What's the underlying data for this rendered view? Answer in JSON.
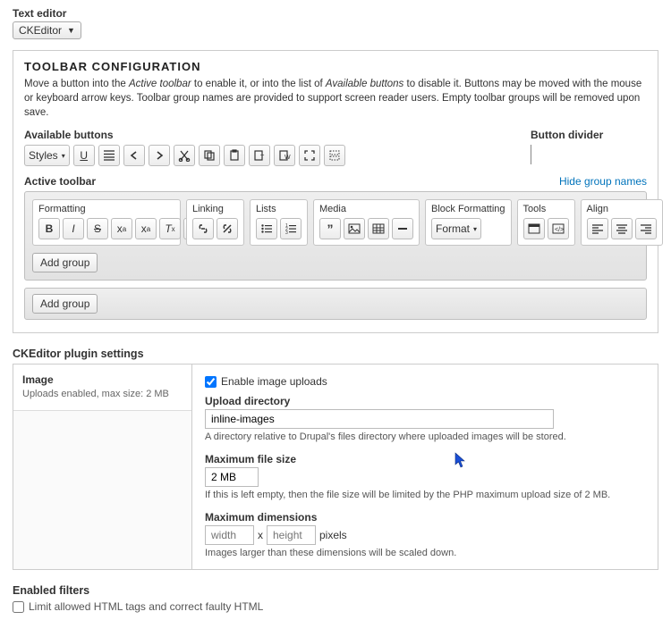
{
  "textEditor": {
    "label": "Text editor",
    "selected": "CKEditor"
  },
  "toolbarConfig": {
    "title": "TOOLBAR CONFIGURATION",
    "desc_pre": "Move a button into the ",
    "desc_em1": "Active toolbar",
    "desc_mid": " to enable it, or into the list of ",
    "desc_em2": "Available buttons",
    "desc_post": " to disable it. Buttons may be moved with the mouse or keyboard arrow keys. Toolbar group names are provided to support screen reader users. Empty toolbar groups will be removed upon save.",
    "available_label": "Available buttons",
    "divider_label": "Button divider",
    "styles_label": "Styles",
    "active_label": "Active toolbar",
    "hide_link": "Hide group names",
    "groups": {
      "formatting": "Formatting",
      "linking": "Linking",
      "lists": "Lists",
      "media": "Media",
      "block": "Block Formatting",
      "tools": "Tools",
      "align": "Align"
    },
    "format_label": "Format",
    "add_group": "Add group"
  },
  "pluginSettings": {
    "title": "CKEditor plugin settings",
    "tab": {
      "name": "Image",
      "desc": "Uploads enabled, max size: 2 MB"
    },
    "enable_label": "Enable image uploads",
    "enable_checked": true,
    "upload_dir_label": "Upload directory",
    "upload_dir_value": "inline-images",
    "upload_dir_hint": "A directory relative to Drupal's files directory where uploaded images will be stored.",
    "max_size_label": "Maximum file size",
    "max_size_value": "2 MB",
    "max_size_hint": "If this is left empty, then the file size will be limited by the PHP maximum upload size of 2 MB.",
    "max_dim_label": "Maximum dimensions",
    "width_ph": "width",
    "height_ph": "height",
    "times": "x",
    "pixels": "pixels",
    "max_dim_hint": "Images larger than these dimensions will be scaled down."
  },
  "filters": {
    "title": "Enabled filters",
    "limit_label": "Limit allowed HTML tags and correct faulty HTML"
  }
}
